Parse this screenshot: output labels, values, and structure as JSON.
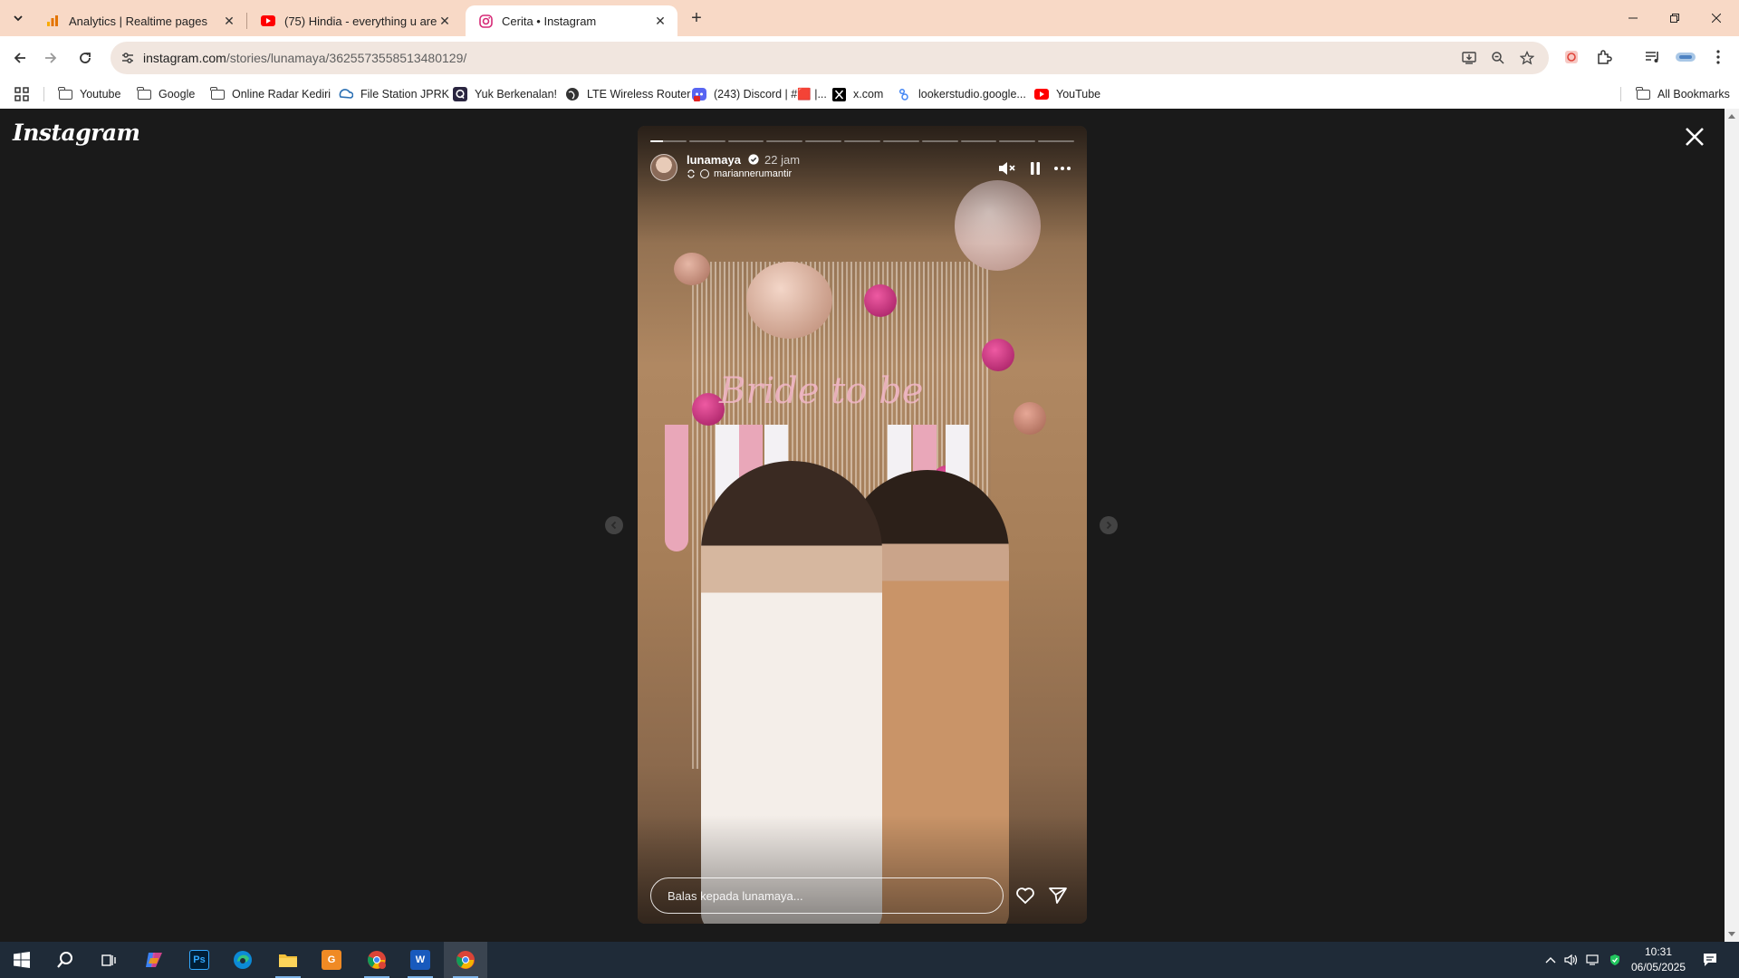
{
  "browser": {
    "tabs": [
      {
        "title": "Analytics | Realtime pages",
        "icon": "analytics-icon"
      },
      {
        "title": "(75) Hindia - everything u are -",
        "icon": "youtube-icon"
      },
      {
        "title": "Cerita • Instagram",
        "icon": "instagram-icon"
      }
    ],
    "url_host": "instagram.com",
    "url_path": "/stories/lunamaya/3625573558513480129/",
    "bookmarks": [
      {
        "label": "Youtube",
        "icon": "folder-icon"
      },
      {
        "label": "Google",
        "icon": "folder-icon"
      },
      {
        "label": "Online Radar Kediri",
        "icon": "folder-icon"
      },
      {
        "label": "File Station JPRK",
        "icon": "file-station-icon"
      },
      {
        "label": "Yuk Berkenalan!",
        "icon": "q-icon"
      },
      {
        "label": "LTE Wireless Router",
        "icon": "globe-icon"
      },
      {
        "label": "(243) Discord | #🟥 |...",
        "icon": "discord-icon"
      },
      {
        "label": "x.com",
        "icon": "x-icon"
      },
      {
        "label": "lookerstudio.google...",
        "icon": "looker-icon"
      },
      {
        "label": "YouTube",
        "icon": "youtube-icon"
      }
    ],
    "all_bookmarks": "All Bookmarks"
  },
  "instagram": {
    "logo": "Instagram",
    "story": {
      "username": "lunamaya",
      "time": "22 jam",
      "subline": "mariannerumantir",
      "segments_total": 11,
      "segments_done": 0,
      "current_progress": 0.35,
      "reply_placeholder": "Balas kepada lunamaya...",
      "banner_text": "Bride to be"
    }
  },
  "taskbar": {
    "apps": [
      "windows-start",
      "search",
      "task-view",
      "copilot",
      "photoshop",
      "edge",
      "file-explorer",
      "grammarly-pro",
      "chrome-profile",
      "word",
      "chrome"
    ],
    "time": "10:31",
    "date": "06/05/2025"
  },
  "colors": {
    "tabbar": "#f8d9c6",
    "ig_bg": "#1a1a1a",
    "taskbar": "#1f2b38"
  }
}
